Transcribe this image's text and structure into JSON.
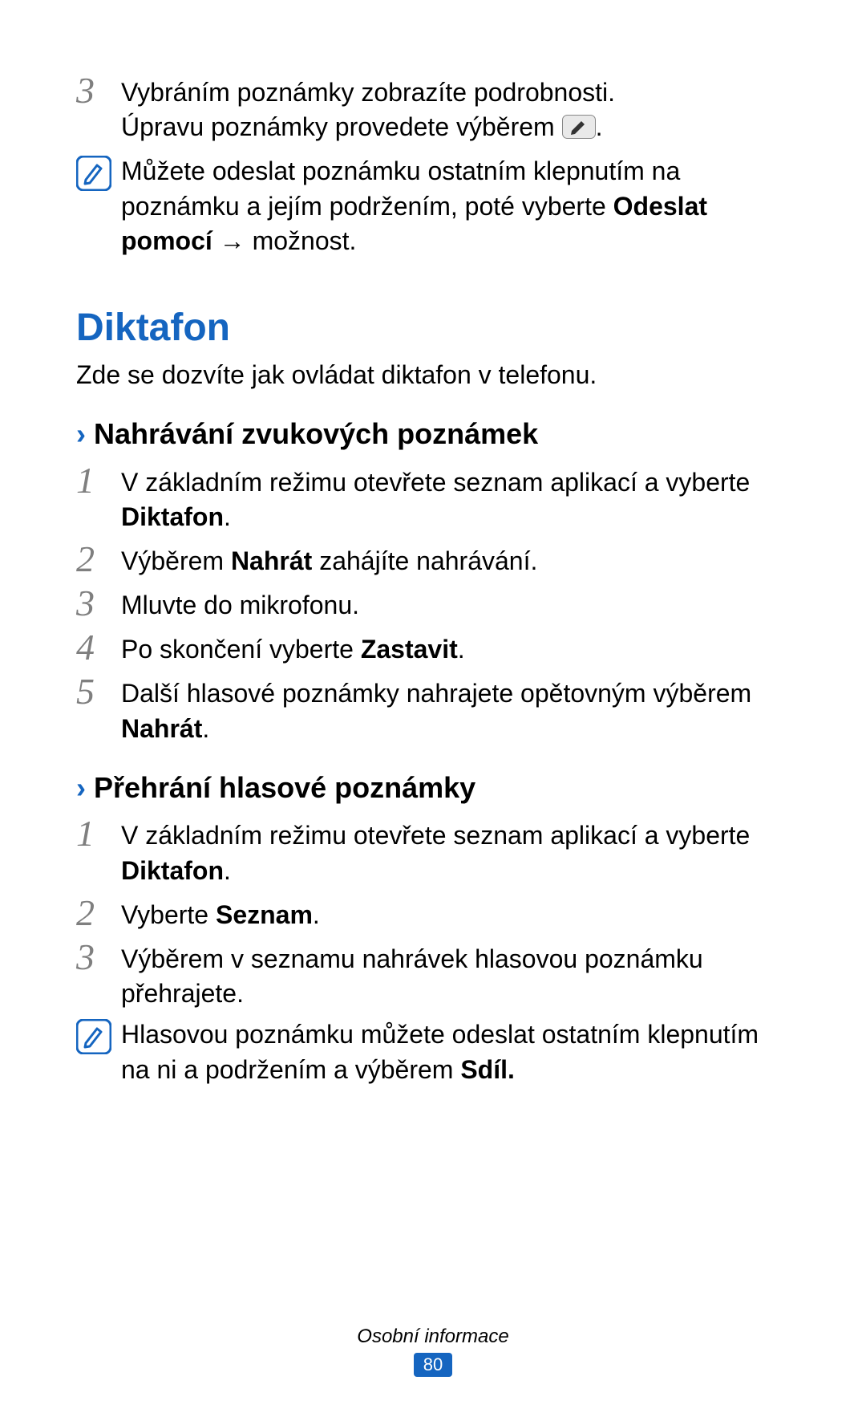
{
  "top_step": {
    "number": "3",
    "line1": "Vybráním poznámky zobrazíte podrobnosti.",
    "line2_pre": "Úpravu poznámky provedete výběrem ",
    "line2_post": "."
  },
  "icons": {
    "tip": "note-icon",
    "edit": "edit-icon"
  },
  "tip1": {
    "pre": "Můžete odeslat poznámku ostatním klepnutím na poznámku a jejím podržením, poté vyberte ",
    "bold": "Odeslat pomocí",
    "arrow": " → ",
    "post": "možnost."
  },
  "section": {
    "title": "Diktafon",
    "desc": "Zde se dozvíte jak ovládat diktafon v telefonu."
  },
  "sub1": {
    "chevron": "›",
    "title": "Nahrávání zvukových poznámek",
    "steps": [
      {
        "n": "1",
        "pre": "V základním režimu otevřete seznam aplikací a vyberte ",
        "bold": "Diktafon",
        "post": "."
      },
      {
        "n": "2",
        "pre": "Výběrem ",
        "bold": "Nahrát",
        "post": " zahájíte nahrávání."
      },
      {
        "n": "3",
        "pre": "Mluvte do mikrofonu.",
        "bold": "",
        "post": ""
      },
      {
        "n": "4",
        "pre": "Po skončení vyberte ",
        "bold": "Zastavit",
        "post": "."
      },
      {
        "n": "5",
        "pre": "Další hlasové poznámky nahrajete opětovným výběrem ",
        "bold": "Nahrát",
        "post": "."
      }
    ]
  },
  "sub2": {
    "chevron": "›",
    "title": "Přehrání hlasové poznámky",
    "steps": [
      {
        "n": "1",
        "pre": "V základním režimu otevřete seznam aplikací a vyberte ",
        "bold": "Diktafon",
        "post": "."
      },
      {
        "n": "2",
        "pre": "Vyberte ",
        "bold": "Seznam",
        "post": "."
      },
      {
        "n": "3",
        "pre": "Výběrem v seznamu nahrávek hlasovou poznámku přehrajete.",
        "bold": "",
        "post": ""
      }
    ]
  },
  "tip2": {
    "pre": "Hlasovou poznámku můžete odeslat ostatním klepnutím na ni a podržením a výběrem ",
    "bold": "Sdíl."
  },
  "footer": {
    "section": "Osobní informace",
    "page": "80"
  }
}
